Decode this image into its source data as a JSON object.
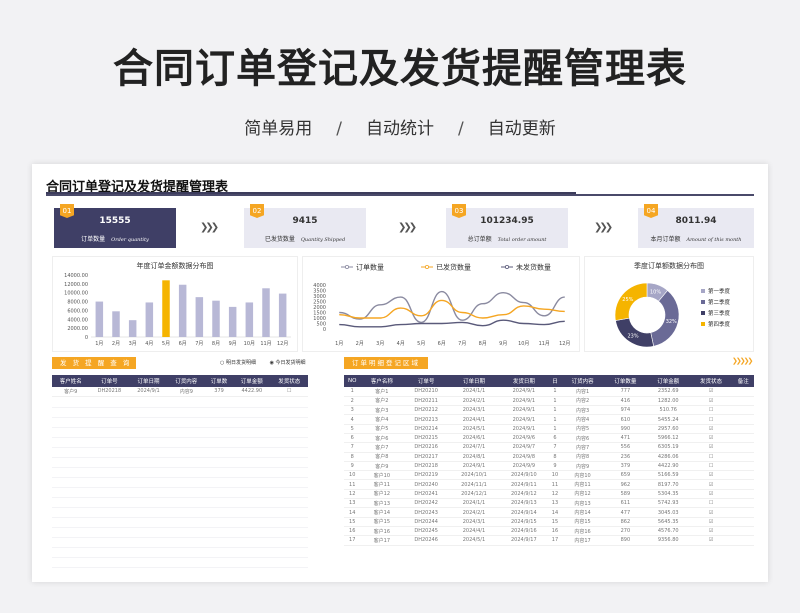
{
  "hero": {
    "title": "合同订单登记及发货提醒管理表",
    "tags": [
      "简单易用",
      "自动统计",
      "自动更新"
    ],
    "sep": "/"
  },
  "sheet_title": "合同订单登记及发货提醒管理表",
  "kpis": [
    {
      "num": "01",
      "value": "15555",
      "label": "订单数量",
      "label_en": "Order quantity"
    },
    {
      "num": "02",
      "value": "9415",
      "label": "已发货数量",
      "label_en": "Quantity Shipped"
    },
    {
      "num": "03",
      "value": "101234.95",
      "label": "总订单额",
      "label_en": "Total order amount"
    },
    {
      "num": "04",
      "value": "8011.94",
      "label": "本月订单额",
      "label_en": "Amount of this month"
    }
  ],
  "arrow": "❯❯❯",
  "bar_chart_title": "年度订单金额数据分布图",
  "line_legend": [
    "订单数量",
    "已发货数量",
    "未发货数量"
  ],
  "pie_chart_title": "季度订单额数据分布图",
  "chart_data": [
    {
      "type": "bar",
      "title": "年度订单金额数据分布图",
      "categories": [
        "1月",
        "2月",
        "3月",
        "4月",
        "5月",
        "6月",
        "7月",
        "8月",
        "9月",
        "10月",
        "11月",
        "12月"
      ],
      "values": [
        8000,
        5800,
        3800,
        7800,
        12800,
        11800,
        9000,
        8200,
        6800,
        7800,
        11000,
        9800
      ],
      "highlight_index": 4,
      "yticks": [
        "0",
        "2000.00",
        "4000.00",
        "6000.00",
        "8000.00",
        "10000.00",
        "12000.00",
        "14000.00"
      ],
      "ylim": [
        0,
        14000
      ],
      "colors": {
        "bar": "#b8b8d6",
        "highlight": "#f5b400"
      }
    },
    {
      "type": "line",
      "categories": [
        "1月",
        "2月",
        "3月",
        "4月",
        "5月",
        "6月",
        "7月",
        "8月",
        "9月",
        "10月",
        "11月",
        "12月"
      ],
      "yticks": [
        "0",
        "500",
        "1000",
        "1500",
        "2000",
        "2500",
        "3000",
        "3500",
        "4000"
      ],
      "ylim": [
        0,
        4000
      ],
      "series": [
        {
          "name": "订单数量",
          "color": "#8a8aa0",
          "values": [
            1500,
            900,
            2200,
            2900,
            600,
            3400,
            800,
            2300,
            3300,
            2400,
            1200,
            2900
          ]
        },
        {
          "name": "已发货数量",
          "color": "#f5a623",
          "values": [
            1300,
            1000,
            1000,
            1900,
            1200,
            2600,
            1500,
            1000,
            1300,
            2100,
            1800,
            1600
          ]
        },
        {
          "name": "未发货数量",
          "color": "#5a5a7a",
          "values": [
            400,
            200,
            200,
            400,
            500,
            500,
            600,
            300,
            800,
            500,
            400,
            700
          ]
        }
      ]
    },
    {
      "type": "pie",
      "title": "季度订单额数据分布图",
      "labels": [
        "第一季度",
        "第二季度",
        "第三季度",
        "第四季度"
      ],
      "values": [
        10,
        32,
        23,
        25
      ],
      "display": [
        "10%",
        "32%",
        "23%",
        "25%"
      ],
      "colors": [
        "#a6a6c6",
        "#6a6a96",
        "#3f3f66",
        "#f5b400"
      ]
    }
  ],
  "query": {
    "title": "发 货 提 醒 查 询",
    "radio": [
      "明日发货明细",
      "今日发货明细"
    ],
    "headers": [
      "客户姓名",
      "订单号",
      "订单日期",
      "订货内容",
      "订单数",
      "订单金额",
      "发货状态"
    ],
    "row": [
      "客户9",
      "DH20218",
      "2024/9/1",
      "内容9",
      "379",
      "4422.90",
      "☐"
    ]
  },
  "detail": {
    "title": "订单明细登记区域",
    "chevrons": "❯❯❯❯❯",
    "headers": [
      "NO",
      "客户名称",
      "订单号",
      "订单日期",
      "发货日期",
      "日",
      "订货内容",
      "订单数量",
      "订单金额",
      "发货状态",
      "备注"
    ],
    "rows": [
      [
        "1",
        "客户1",
        "DH20210",
        "2024/1/1",
        "2024/9/1",
        "1",
        "内容1",
        "777",
        "2352.69",
        "☑",
        ""
      ],
      [
        "2",
        "客户2",
        "DH20211",
        "2024/2/1",
        "2024/9/1",
        "1",
        "内容2",
        "416",
        "1282.00",
        "☑",
        ""
      ],
      [
        "3",
        "客户3",
        "DH20212",
        "2024/3/1",
        "2024/9/1",
        "1",
        "内容3",
        "974",
        "510.76",
        "☐",
        ""
      ],
      [
        "4",
        "客户4",
        "DH20213",
        "2024/4/1",
        "2024/9/1",
        "1",
        "内容4",
        "610",
        "5455.24",
        "☐",
        ""
      ],
      [
        "5",
        "客户5",
        "DH20214",
        "2024/5/1",
        "2024/9/1",
        "1",
        "内容5",
        "990",
        "2957.60",
        "☑",
        ""
      ],
      [
        "6",
        "客户6",
        "DH20215",
        "2024/6/1",
        "2024/9/6",
        "6",
        "内容6",
        "471",
        "5966.12",
        "☑",
        ""
      ],
      [
        "7",
        "客户7",
        "DH20216",
        "2024/7/1",
        "2024/9/7",
        "7",
        "内容7",
        "556",
        "6305.19",
        "☑",
        ""
      ],
      [
        "8",
        "客户8",
        "DH20217",
        "2024/8/1",
        "2024/9/8",
        "8",
        "内容8",
        "236",
        "4286.06",
        "☐",
        ""
      ],
      [
        "9",
        "客户9",
        "DH20218",
        "2024/9/1",
        "2024/9/9",
        "9",
        "内容9",
        "379",
        "4422.90",
        "☐",
        ""
      ],
      [
        "10",
        "客户10",
        "DH20219",
        "2024/10/1",
        "2024/9/10",
        "10",
        "内容10",
        "659",
        "5166.59",
        "☑",
        ""
      ],
      [
        "11",
        "客户11",
        "DH20240",
        "2024/11/1",
        "2024/9/11",
        "11",
        "内容11",
        "962",
        "8197.70",
        "☑",
        ""
      ],
      [
        "12",
        "客户12",
        "DH20241",
        "2024/12/1",
        "2024/9/12",
        "12",
        "内容12",
        "589",
        "5304.35",
        "☑",
        ""
      ],
      [
        "13",
        "客户13",
        "DH20242",
        "2024/1/1",
        "2024/9/13",
        "13",
        "内容13",
        "611",
        "5742.93",
        "☐",
        ""
      ],
      [
        "14",
        "客户14",
        "DH20243",
        "2024/2/1",
        "2024/9/14",
        "14",
        "内容14",
        "477",
        "3045.03",
        "☑",
        ""
      ],
      [
        "15",
        "客户15",
        "DH20244",
        "2024/3/1",
        "2024/9/15",
        "15",
        "内容15",
        "862",
        "5645.35",
        "☑",
        ""
      ],
      [
        "16",
        "客户16",
        "DH20245",
        "2024/4/1",
        "2024/9/16",
        "16",
        "内容16",
        "270",
        "4576.70",
        "☑",
        ""
      ],
      [
        "17",
        "客户17",
        "DH20246",
        "2024/5/1",
        "2024/9/17",
        "17",
        "内容17",
        "890",
        "9356.80",
        "☑",
        ""
      ]
    ]
  }
}
